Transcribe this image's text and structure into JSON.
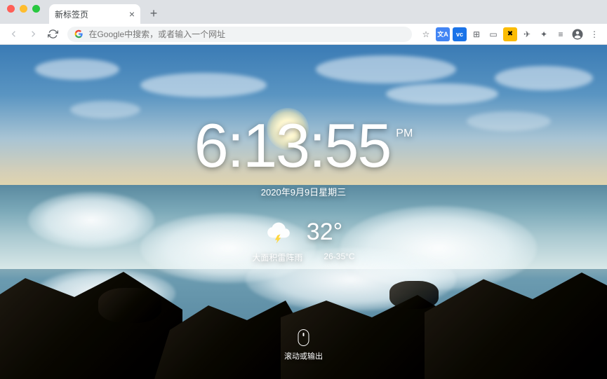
{
  "tab": {
    "title": "新标签页"
  },
  "omnibox": {
    "placeholder": "在Google中搜索，或者输入一个网址"
  },
  "clock": {
    "time": "6:13:55",
    "ampm": "PM"
  },
  "date": "2020年9月9日星期三",
  "weather": {
    "temp": "32°",
    "desc": "大面积雷阵雨",
    "range": "26-35°C"
  },
  "scroll_hint": "滚动或输出"
}
